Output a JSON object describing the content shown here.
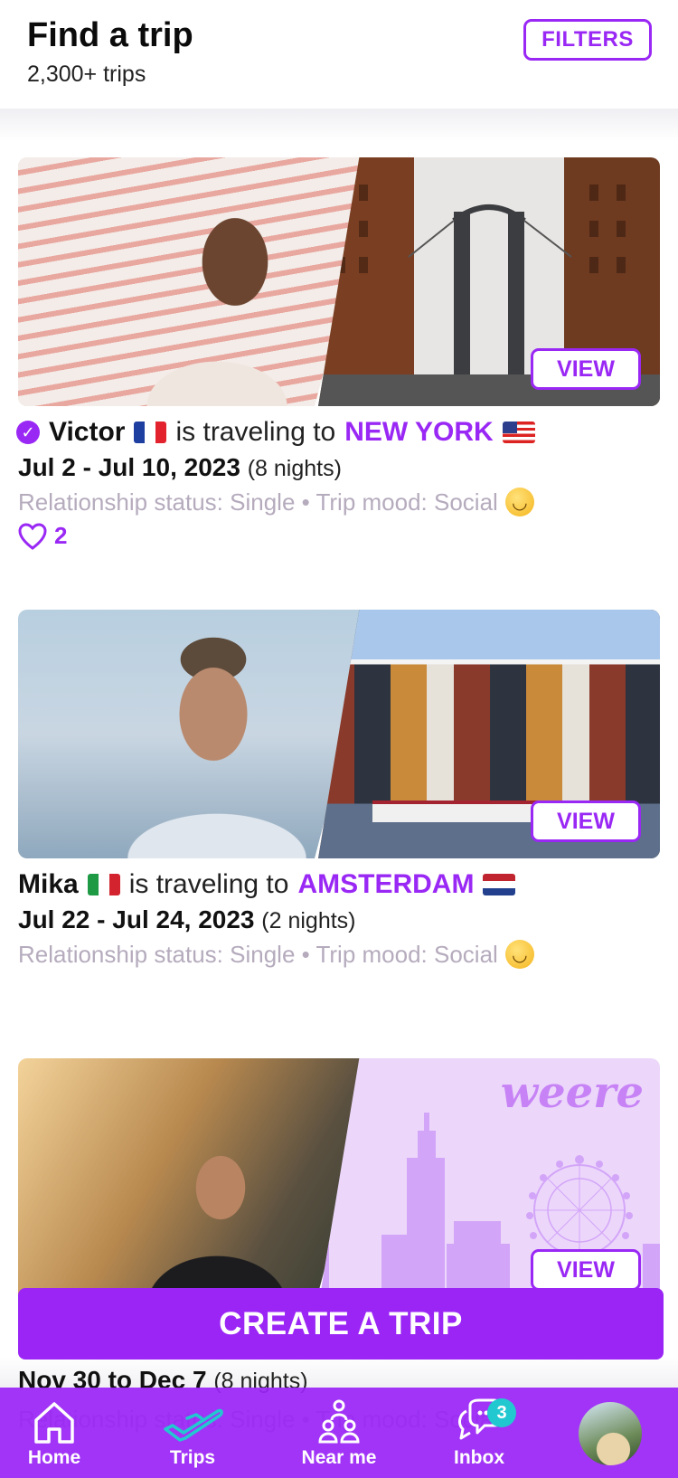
{
  "header": {
    "title": "Find a trip",
    "subtitle": "2,300+ trips",
    "filters_label": "FILTERS"
  },
  "trips": [
    {
      "name": "Victor",
      "verified": true,
      "home_flag": "France",
      "traveling_text": "is traveling to",
      "destination": "NEW YORK",
      "destination_flag": "United States",
      "dates": "Jul 2 - Jul 10, 2023",
      "nights": "(8 nights)",
      "details": "Relationship status: Single • Trip mood: Social",
      "mood_icon": "slightly-smiling-face",
      "likes": "2",
      "view_label": "VIEW"
    },
    {
      "name": "Mika",
      "verified": false,
      "home_flag": "Italy",
      "traveling_text": "is traveling to",
      "destination": "AMSTERDAM",
      "destination_flag": "Netherlands",
      "dates": "Jul 22 - Jul 24, 2023",
      "nights": "(2 nights)",
      "details": "Relationship status: Single • Trip mood: Social",
      "mood_icon": "slightly-smiling-face",
      "view_label": "VIEW"
    },
    {
      "dates": "Nov 30 to Dec 7",
      "nights": "(8 nights)",
      "details": "Relationship status: Single • Trip mood: Social",
      "placeholder_brand": "weere",
      "view_label": "VIEW"
    }
  ],
  "create_trip_label": "CREATE A TRIP",
  "nav": {
    "items": [
      {
        "label": "Home",
        "icon": "home-icon"
      },
      {
        "label": "Trips",
        "icon": "airplane-icon",
        "active": true
      },
      {
        "label": "Near me",
        "icon": "people-icon"
      },
      {
        "label": "Inbox",
        "icon": "chat-icon",
        "badge": "3"
      }
    ]
  },
  "colors": {
    "accent": "#9a28f5",
    "badge": "#22c8d0",
    "active_icon": "#22c8d0",
    "muted_text": "#b5abbd"
  }
}
